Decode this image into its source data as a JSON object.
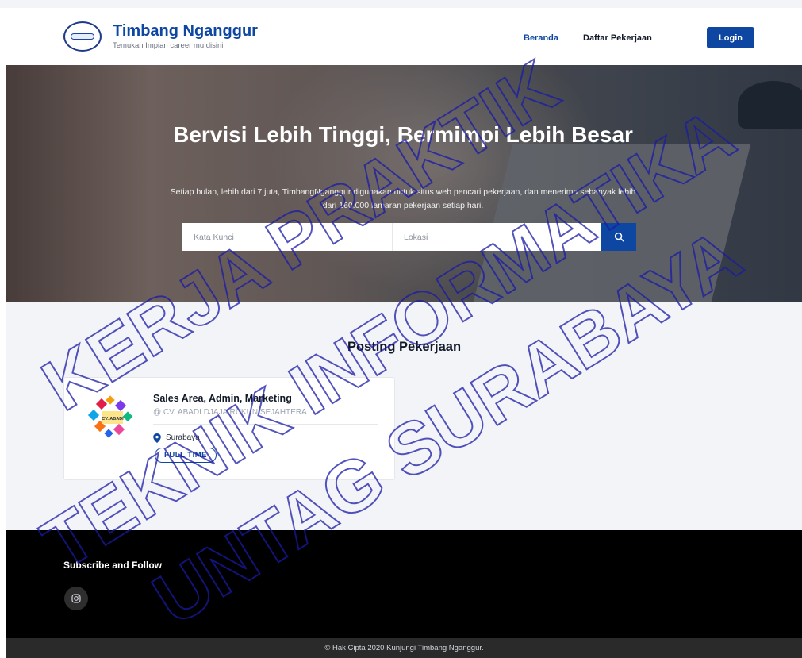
{
  "header": {
    "brand_title": "Timbang Nganggur",
    "brand_tagline": "Temukan Impian career mu disini",
    "nav": {
      "home": "Beranda",
      "jobs": "Daftar Pekerjaan"
    },
    "login_label": "Login"
  },
  "hero": {
    "title": "Bervisi Lebih Tinggi, Bermimpi Lebih Besar",
    "subtitle": "Setiap bulan, lebih dari 7 juta, TimbangNganggur digunakan untuk situs web pencari pekerjaan, dan menerima sebanyak lebih dari 160.000 lamaran pekerjaan setiap hari.",
    "search": {
      "keyword_placeholder": "Kata Kunci",
      "location_placeholder": "Lokasi"
    }
  },
  "jobs_section": {
    "title": "Posting Pekerjaan",
    "jobs": [
      {
        "title": "Sales Area, Admin, Marketing",
        "company": "@ CV. ABADI DJAJA RUKUN SEJAHTERA",
        "location": "Surabaya",
        "type": "FULL TIME"
      }
    ]
  },
  "footer": {
    "title": "Subscribe and Follow",
    "social_icon": "instagram-icon",
    "copyright": "© Hak Cipta 2020 Kunjungi Timbang Nganggur."
  },
  "watermark": {
    "lines": [
      "KERJA PRAKTIK",
      "TEKNIK INFORMATIKA",
      "UNTAG SURABAYA"
    ],
    "color": "#1a1aa6"
  },
  "colors": {
    "brand": "#0d47a1",
    "footer": "#000000",
    "section_bg": "#f3f4f7"
  }
}
